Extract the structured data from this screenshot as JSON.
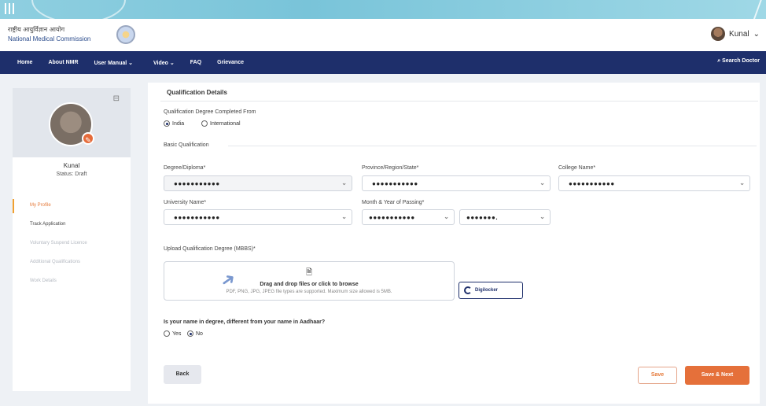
{
  "header": {
    "brand_hi": "राष्ट्रीय आयुर्विज्ञान आयोग",
    "brand_en": "National Medical Commission",
    "user_name": "Kunal",
    "user_chevron": "⌄"
  },
  "nav": {
    "items": [
      "Home",
      "About NMR",
      "User Manual ⌄",
      "Video ⌄",
      "FAQ",
      "Grievance"
    ],
    "search": "Search Doctor"
  },
  "sidebar": {
    "menu_glyph": "⊟",
    "name": "Kunal",
    "status": "Status: Draft",
    "items": [
      "My Profile",
      "Track Application",
      "Voluntary Suspend Licence",
      "Additional Qualifications",
      "Work Details"
    ]
  },
  "form": {
    "section_title": "Qualification Details",
    "degree_from_label": "Qualification Degree Completed From",
    "options_from": [
      "India",
      "International"
    ],
    "basic_label": "Basic Qualification",
    "degree_label": "Degree/Diploma*",
    "degree_value": "●●●●●●●●●●●",
    "province_label": "Province/Region/State*",
    "province_value": "●●●●●●●●●●●",
    "college_label": "College Name*",
    "college_value": "●●●●●●●●●●●",
    "university_label": "University Name*",
    "university_value": "●●●●●●●●●●●",
    "month_year_label": "Month & Year of Passing*",
    "month_value": "●●●●●●●●●●●",
    "year_value": "●●●●●●●.",
    "upload_label": "Upload Qualification Degree (MBBS)*",
    "upload_main": "Drag and drop files or click to browse",
    "upload_hint": "PDF, PNG, JPG, JPEG file types are supported. Maximum size allowed is 5MB.",
    "digilocker": "Digilocker",
    "name_diff_question": "Is your name in degree, different from your name in Aadhaar?",
    "options_yesno": [
      "Yes",
      "No"
    ]
  },
  "buttons": {
    "back": "Back",
    "save": "Save",
    "save_next": "Save & Next"
  },
  "colors": {
    "nav_bg": "#1e2f6b",
    "accent": "#e5703a"
  }
}
